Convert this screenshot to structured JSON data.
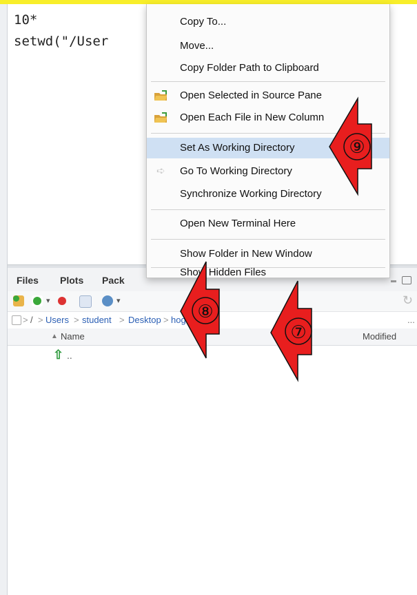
{
  "console": {
    "line1": "10*",
    "line2": "setwd(\"/User"
  },
  "context_menu": {
    "items": [
      {
        "label": "Copy To..."
      },
      {
        "label": "Move..."
      },
      {
        "label": "Copy Folder Path to Clipboard"
      },
      {
        "label": "Open Selected in Source Pane",
        "icon": "folder-open-icon"
      },
      {
        "label": "Open Each File in New Column",
        "icon": "folder-open-icon"
      },
      {
        "label": "Set As Working Directory",
        "highlighted": true
      },
      {
        "label": "Go To Working Directory",
        "icon": "arrow-right-icon"
      },
      {
        "label": "Synchronize Working Directory"
      },
      {
        "label": "Open New Terminal Here"
      },
      {
        "label": "Show Folder in New Window"
      },
      {
        "label": "Show Hidden Files"
      }
    ]
  },
  "files_pane": {
    "tabs": [
      "Files",
      "Plots",
      "Pack"
    ],
    "breadcrumb": [
      "/",
      "Users",
      "student",
      "Desktop",
      "hoge"
    ],
    "breadcrumb_more": "...",
    "columns": {
      "name": "Name",
      "modified": "Modified"
    },
    "rows": [
      {
        "name": ".."
      }
    ]
  },
  "annotations": {
    "step7": "⑦",
    "step8": "⑧",
    "step9": "⑨",
    "arrow_color": "#e81e1e",
    "highlight_color": "#f8ee2a"
  }
}
